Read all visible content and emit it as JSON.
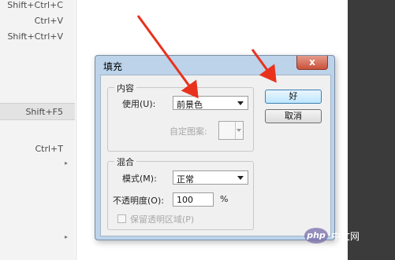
{
  "menu": {
    "rows": [
      {
        "shortcut": "Shift+Ctrl+C",
        "arrow": ""
      },
      {
        "shortcut": "Ctrl+V",
        "arrow": ""
      },
      {
        "shortcut": "Shift+Ctrl+V",
        "arrow": ""
      },
      {
        "shortcut": "Shift+F5",
        "arrow": ""
      },
      {
        "shortcut": "Ctrl+T",
        "arrow": ""
      },
      {
        "shortcut": "",
        "arrow": "▸"
      },
      {
        "shortcut": "",
        "arrow": "▸"
      }
    ]
  },
  "dialog": {
    "title": "填充",
    "close_label": "x",
    "content_group": {
      "legend": "内容",
      "use_label": "使用(U):",
      "use_value": "前景色",
      "custom_pattern_label": "自定图案:"
    },
    "blend_group": {
      "legend": "混合",
      "mode_label": "模式(M):",
      "mode_value": "正常",
      "opacity_label": "不透明度(O):",
      "opacity_value": "100",
      "opacity_unit": "%",
      "preserve_label": "保留透明区域(P)",
      "preserve_checked": false
    },
    "ok_label": "好",
    "cancel_label": "取消"
  },
  "watermark": {
    "logo_text": "php",
    "site_text": "中文网"
  },
  "colors": {
    "arrow": "#e8321e",
    "dialog_frame": "#bcd3ea",
    "right_panel": "#3b3b3b"
  }
}
